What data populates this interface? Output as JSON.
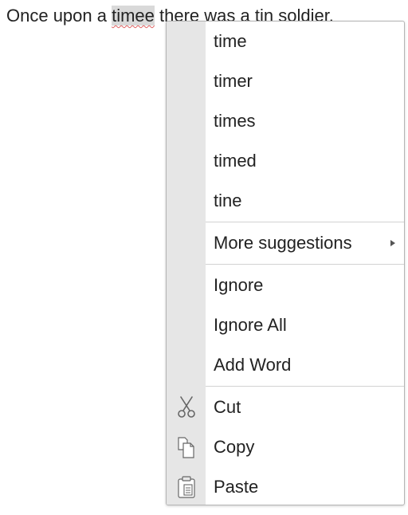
{
  "document": {
    "before": "Once upon a ",
    "misspelled_word": "timee",
    "after": " there was a tin soldier."
  },
  "context_menu": {
    "suggestions": [
      "time",
      "timer",
      "times",
      "timed",
      "tine"
    ],
    "more_suggestions": "More suggestions",
    "spell_actions": {
      "ignore": "Ignore",
      "ignore_all": "Ignore All",
      "add_word": "Add Word"
    },
    "edit_actions": {
      "cut": "Cut",
      "copy": "Copy",
      "paste": "Paste"
    },
    "icons": {
      "cut": "scissors-icon",
      "copy": "copy-icon",
      "paste": "clipboard-icon",
      "more_suggestions": "submenu-arrow-icon"
    },
    "colors": {
      "gutter": "#e6e6e6",
      "border": "#b5b5b5",
      "misspelled_highlight": "#d9d9d9",
      "squiggle": "#e06060"
    }
  }
}
